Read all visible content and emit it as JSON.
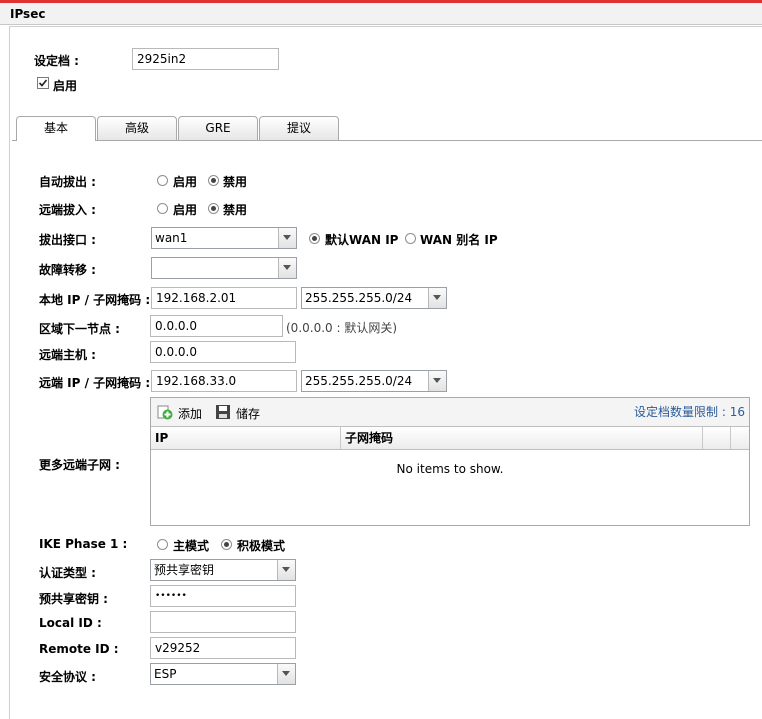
{
  "window": {
    "title": "IPsec"
  },
  "profile": {
    "label": "设定档 :",
    "value": "2925in2"
  },
  "enable": {
    "label": "启用",
    "checked": true
  },
  "tabs": [
    {
      "label": "基本",
      "active": true
    },
    {
      "label": "高级",
      "active": false
    },
    {
      "label": "GRE",
      "active": false
    },
    {
      "label": "提议",
      "active": false
    }
  ],
  "auto_dial_out": {
    "label": "自动拔出 :",
    "options": [
      "启用",
      "禁用"
    ],
    "selected": "禁用"
  },
  "remote_dial_in": {
    "label": "远端拔入 :",
    "options": [
      "启用",
      "禁用"
    ],
    "selected": "禁用"
  },
  "dial_out_interface": {
    "label": "拔出接口 :",
    "value": "wan1",
    "ip_options": [
      "默认WAN IP",
      "WAN 别名 IP"
    ],
    "ip_selected": "默认WAN IP"
  },
  "failover": {
    "label": "故障转移 :",
    "value": ""
  },
  "local_ip": {
    "label": "本地 IP / 子网掩码 :",
    "ip": "192.168.2.01",
    "mask": "255.255.255.0/24"
  },
  "next_hop": {
    "label": "区域下一节点 :",
    "value": "0.0.0.0",
    "hint": "(0.0.0.0 : 默认网关)"
  },
  "remote_host": {
    "label": "远端主机 :",
    "value": "0.0.0.0"
  },
  "remote_ip": {
    "label": "远端 IP / 子网掩码 :",
    "ip": "192.168.33.0",
    "mask": "255.255.255.0/24"
  },
  "more_subnets": {
    "label": "更多远端子网 :",
    "add_label": "添加",
    "save_label": "储存",
    "limit_text": "设定档数量限制 : 16",
    "columns": [
      "IP",
      "子网掩码"
    ],
    "empty_text": "No items to show."
  },
  "ike_phase1": {
    "label": "IKE Phase 1 :",
    "options": [
      "主模式",
      "积极模式"
    ],
    "selected": "积极模式"
  },
  "auth_type": {
    "label": "认证类型 :",
    "value": "预共享密钥"
  },
  "psk": {
    "label": "预共享密钥 :",
    "value": "••••••"
  },
  "local_id": {
    "label": "Local ID :",
    "value": ""
  },
  "remote_id": {
    "label": "Remote ID :",
    "value": "v29252"
  },
  "security_protocol": {
    "label": "安全协议 :",
    "value": "ESP"
  },
  "colors": {
    "accent_bar": "#e03030",
    "add_icon": "#3fae3f"
  }
}
